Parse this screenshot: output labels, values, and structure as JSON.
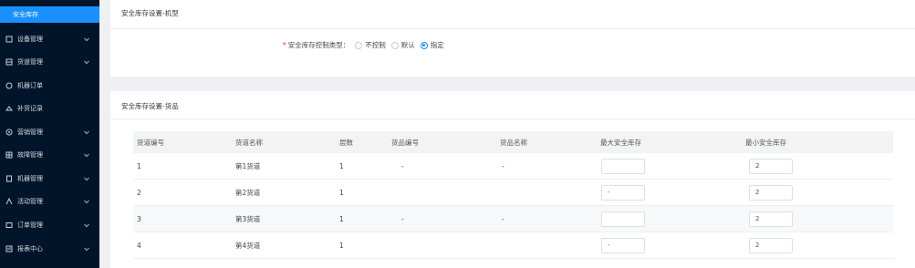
{
  "sidebar": {
    "active": "安全库存",
    "items": [
      {
        "label": "设备管理",
        "icon": "device-icon"
      },
      {
        "label": "货道管理",
        "icon": "aisle-icon"
      },
      {
        "label": "机器订单",
        "icon": "order-icon"
      },
      {
        "label": "补货记录",
        "icon": "restock-icon"
      },
      {
        "label": "营销管理",
        "icon": "marketing-icon"
      },
      {
        "label": "故障管理",
        "icon": "fault-icon"
      },
      {
        "label": "机器管理",
        "icon": "machine-icon"
      },
      {
        "label": "活动管理",
        "icon": "activity-icon"
      },
      {
        "label": "订单管理",
        "icon": "order-list-icon"
      },
      {
        "label": "报表中心",
        "icon": "report-icon"
      }
    ]
  },
  "config_card": {
    "title": "安全库存设置-机型",
    "field_label": "安全库存控制类型：",
    "options": [
      "不控制",
      "默认",
      "指定"
    ],
    "selected": "指定"
  },
  "table_card": {
    "title": "安全库存设置-货品",
    "columns": [
      "货道编号",
      "货道名称",
      "层数",
      "货品编号",
      "货品名称",
      "最大安全库存",
      "最小安全库存"
    ],
    "rows": [
      {
        "no": "1",
        "name": "第1货道",
        "layer": "1",
        "goods_no": "-",
        "goods_name": "-",
        "max": "",
        "min": "2"
      },
      {
        "no": "2",
        "name": "第2货道",
        "layer": "1",
        "goods_no": "",
        "goods_name": "",
        "max": "-",
        "min": "2"
      },
      {
        "no": "3",
        "name": "第3货道",
        "layer": "1",
        "goods_no": "-",
        "goods_name": "-",
        "max": "",
        "min": "2"
      },
      {
        "no": "4",
        "name": "第4货道",
        "layer": "1",
        "goods_no": "",
        "goods_name": "",
        "max": "-",
        "min": "2"
      }
    ]
  }
}
